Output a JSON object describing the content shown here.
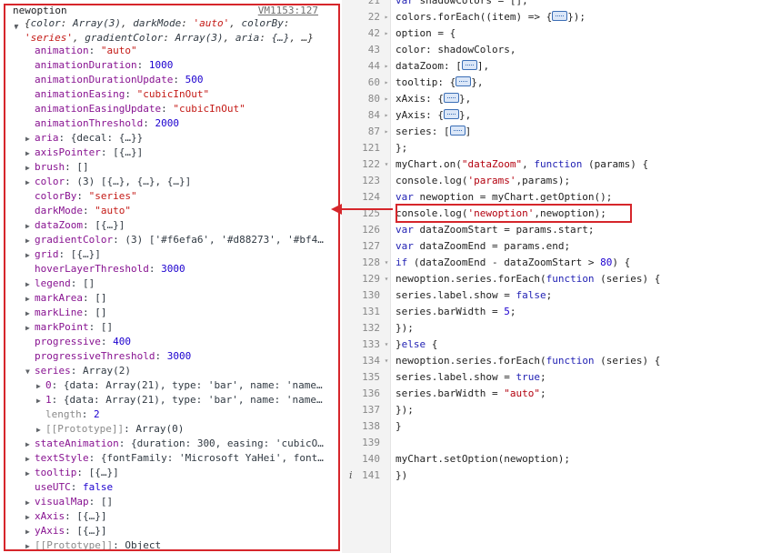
{
  "console": {
    "object_label": "newoption",
    "source_link": "VM1153:127",
    "summary_parts": [
      {
        "k": "color",
        "v": "Array(3)",
        "kind": "plain"
      },
      {
        "k": "darkMode",
        "v": "'auto'",
        "kind": "str"
      },
      {
        "k": "colorBy",
        "v": "'series'",
        "kind": "str"
      },
      {
        "k": "gradientColor",
        "v": "Array(3)",
        "kind": "plain"
      },
      {
        "k": "aria",
        "v": "{…}",
        "kind": "plain"
      }
    ],
    "summary_tail": ", …}",
    "info_icon": "i",
    "properties": [
      {
        "key": "animation",
        "value": "\"auto\"",
        "type": "str",
        "expandable": false
      },
      {
        "key": "animationDuration",
        "value": "1000",
        "type": "num",
        "expandable": false
      },
      {
        "key": "animationDurationUpdate",
        "value": "500",
        "type": "num",
        "expandable": false
      },
      {
        "key": "animationEasing",
        "value": "\"cubicInOut\"",
        "type": "str",
        "expandable": false
      },
      {
        "key": "animationEasingUpdate",
        "value": "\"cubicInOut\"",
        "type": "str",
        "expandable": false
      },
      {
        "key": "animationThreshold",
        "value": "2000",
        "type": "num",
        "expandable": false
      },
      {
        "key": "aria",
        "value": "{decal: {…}}",
        "type": "plain",
        "expandable": true
      },
      {
        "key": "axisPointer",
        "value": "[{…}]",
        "type": "plain",
        "expandable": true
      },
      {
        "key": "brush",
        "value": "[]",
        "type": "plain",
        "expandable": true
      },
      {
        "key": "color",
        "value": "(3) [{…}, {…}, {…}]",
        "type": "plain",
        "expandable": true
      },
      {
        "key": "colorBy",
        "value": "\"series\"",
        "type": "str",
        "expandable": false
      },
      {
        "key": "darkMode",
        "value": "\"auto\"",
        "type": "str",
        "expandable": false
      },
      {
        "key": "dataZoom",
        "value": "[{…}]",
        "type": "plain",
        "expandable": true
      },
      {
        "key": "gradientColor",
        "value": "(3) ['#f6efa6', '#d88273', '#bf4…",
        "type": "plain",
        "expandable": true
      },
      {
        "key": "grid",
        "value": "[{…}]",
        "type": "plain",
        "expandable": true
      },
      {
        "key": "hoverLayerThreshold",
        "value": "3000",
        "type": "num",
        "expandable": false
      },
      {
        "key": "legend",
        "value": "[]",
        "type": "plain",
        "expandable": true
      },
      {
        "key": "markArea",
        "value": "[]",
        "type": "plain",
        "expandable": true
      },
      {
        "key": "markLine",
        "value": "[]",
        "type": "plain",
        "expandable": true
      },
      {
        "key": "markPoint",
        "value": "[]",
        "type": "plain",
        "expandable": true
      },
      {
        "key": "progressive",
        "value": "400",
        "type": "num",
        "expandable": false
      },
      {
        "key": "progressiveThreshold",
        "value": "3000",
        "type": "num",
        "expandable": false
      },
      {
        "key": "series",
        "value": "Array(2)",
        "type": "plain",
        "expandable": true,
        "expanded": true
      },
      {
        "key": "0",
        "value": "{data: Array(21), type: 'bar', name: 'name…",
        "type": "plain",
        "expandable": true,
        "child": true
      },
      {
        "key": "1",
        "value": "{data: Array(21), type: 'bar', name: 'name…",
        "type": "plain",
        "expandable": true,
        "child": true
      },
      {
        "key": "length",
        "value": "2",
        "type": "num",
        "expandable": false,
        "child": true,
        "dimkey": true
      },
      {
        "key": "[[Prototype]]",
        "value": "Array(0)",
        "type": "plain",
        "expandable": true,
        "child": true,
        "dimkey": true
      },
      {
        "key": "stateAnimation",
        "value": "{duration: 300, easing: 'cubicO…",
        "type": "plain",
        "expandable": true
      },
      {
        "key": "textStyle",
        "value": "{fontFamily: 'Microsoft YaHei', font…",
        "type": "plain",
        "expandable": true
      },
      {
        "key": "tooltip",
        "value": "[{…}]",
        "type": "plain",
        "expandable": true
      },
      {
        "key": "useUTC",
        "value": "false",
        "type": "num",
        "expandable": false
      },
      {
        "key": "visualMap",
        "value": "[]",
        "type": "plain",
        "expandable": true
      },
      {
        "key": "xAxis",
        "value": "[{…}]",
        "type": "plain",
        "expandable": true
      },
      {
        "key": "yAxis",
        "value": "[{…}]",
        "type": "plain",
        "expandable": true
      },
      {
        "key": "[[Prototype]]",
        "value": "Object",
        "type": "plain",
        "expandable": true,
        "dimkey": true
      }
    ]
  },
  "source": {
    "lines": [
      {
        "n": "21",
        "fold": "",
        "html": "<span class=\"kw\">var</span> shadowColors = [];"
      },
      {
        "n": "22",
        "fold": "▸",
        "html": "colors.forEach((item) =&gt; {<span class=\"ellipsis-box\"></span>});"
      },
      {
        "n": "42",
        "fold": "▸",
        "html": "option = {"
      },
      {
        "n": "43",
        "fold": "",
        "html": "  color: shadowColors,"
      },
      {
        "n": "44",
        "fold": "▸",
        "html": "  dataZoom: [<span class=\"ellipsis-box\"></span>],"
      },
      {
        "n": "60",
        "fold": "▸",
        "html": "  tooltip: {<span class=\"ellipsis-box\"></span>},"
      },
      {
        "n": "80",
        "fold": "▸",
        "html": "  xAxis: {<span class=\"ellipsis-box\"></span>},"
      },
      {
        "n": "84",
        "fold": "▸",
        "html": "  yAxis: {<span class=\"ellipsis-box\"></span>},"
      },
      {
        "n": "87",
        "fold": "▸",
        "html": "  series: [<span class=\"ellipsis-box\"></span>]"
      },
      {
        "n": "121",
        "fold": "",
        "html": "};"
      },
      {
        "n": "122",
        "fold": "▾",
        "html": "myChart.on(<span class=\"str\">\"dataZoom\"</span>, <span class=\"kw\">function</span> (params) {"
      },
      {
        "n": "123",
        "fold": "",
        "html": "  console.log(<span class=\"str\">'params'</span>,params);"
      },
      {
        "n": "124",
        "fold": "",
        "html": "  <span class=\"kw\">var</span> newoption = myChart.getOption();"
      },
      {
        "n": "125",
        "fold": "",
        "html": "  console.log(<span class=\"str\">'newoption'</span>,newoption);"
      },
      {
        "n": "126",
        "fold": "",
        "html": "  <span class=\"kw\">var</span> dataZoomStart = params.start;"
      },
      {
        "n": "127",
        "fold": "",
        "html": "  <span class=\"kw\">var</span> dataZoomEnd = params.end;"
      },
      {
        "n": "128",
        "fold": "▾",
        "html": "  <span class=\"kw\">if</span> (dataZoomEnd - dataZoomStart &gt; <span class=\"num\">80</span>) {"
      },
      {
        "n": "129",
        "fold": "▾",
        "html": "    newoption.series.forEach(<span class=\"kw\">function</span> (series) {"
      },
      {
        "n": "130",
        "fold": "",
        "html": "      series.label.show = <span class=\"kw\">false</span>;"
      },
      {
        "n": "131",
        "fold": "",
        "html": "      series.barWidth = <span class=\"num\">5</span>;"
      },
      {
        "n": "132",
        "fold": "",
        "html": "    });"
      },
      {
        "n": "133",
        "fold": "▾",
        "html": "  }<span class=\"kw\">else</span> {"
      },
      {
        "n": "134",
        "fold": "▾",
        "html": "    newoption.series.forEach(<span class=\"kw\">function</span> (series) {"
      },
      {
        "n": "135",
        "fold": "",
        "html": "      series.label.show = <span class=\"kw\">true</span>;"
      },
      {
        "n": "136",
        "fold": "",
        "html": "      series.barWidth = <span class=\"str\">\"auto\"</span>;"
      },
      {
        "n": "137",
        "fold": "",
        "html": "    });"
      },
      {
        "n": "138",
        "fold": "",
        "html": "  }"
      },
      {
        "n": "139",
        "fold": "",
        "html": ""
      },
      {
        "n": "140",
        "fold": "",
        "html": "  myChart.setOption(newoption);"
      },
      {
        "n": "141",
        "fold": "",
        "html": "})",
        "marker": "i"
      }
    ]
  },
  "colors": {
    "highlight_red": "#d6262b",
    "keyword_blue": "#1f1fb3",
    "string_red": "#b3000e",
    "property_purple": "#881391"
  }
}
